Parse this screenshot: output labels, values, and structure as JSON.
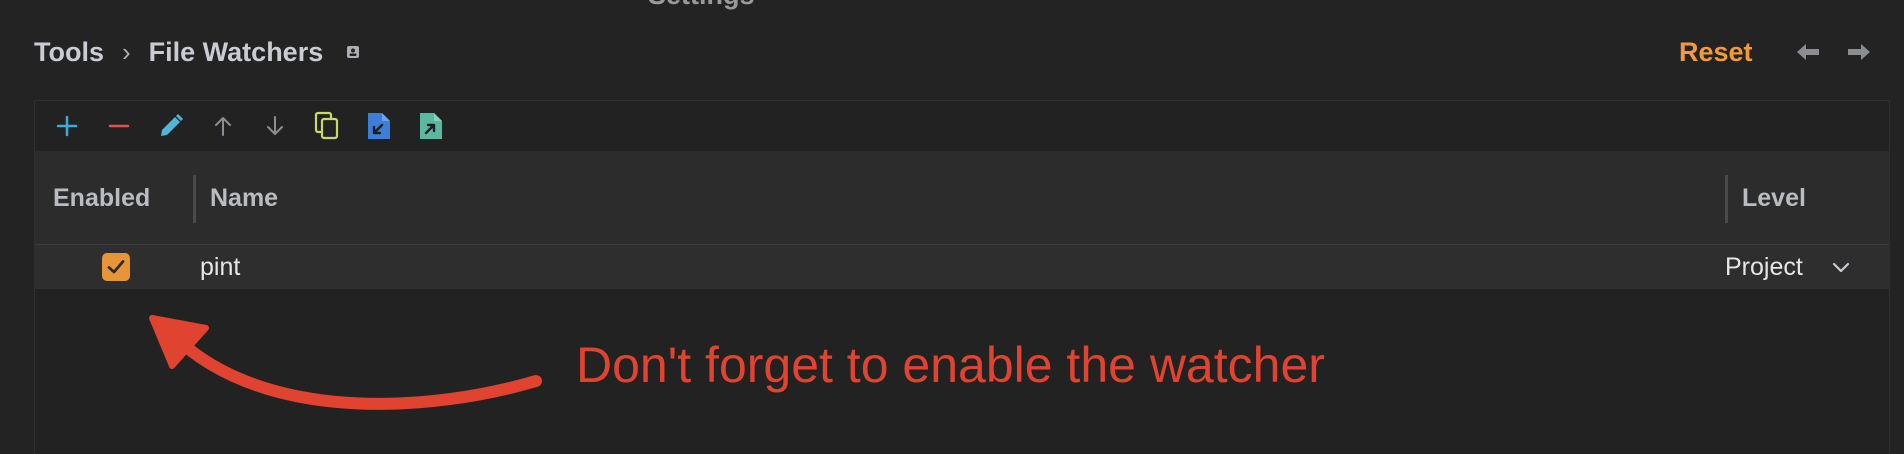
{
  "window": {
    "title": "Settings"
  },
  "breadcrumb": {
    "items": [
      "Tools",
      "File Watchers"
    ],
    "separator": "›"
  },
  "header_actions": {
    "reset_label": "Reset"
  },
  "toolbar": {
    "buttons": [
      {
        "icon": "plus-icon",
        "color": "#3fa9d8"
      },
      {
        "icon": "minus-icon",
        "color": "#e05252"
      },
      {
        "icon": "edit-icon",
        "color": "#4fb5d9"
      },
      {
        "icon": "arrow-up-icon",
        "color": "#8a8f95"
      },
      {
        "icon": "arrow-down-icon",
        "color": "#8a8f95"
      },
      {
        "icon": "copy-icon",
        "color": "#c8d86a"
      },
      {
        "icon": "import-icon",
        "color": "#3d7fd6"
      },
      {
        "icon": "export-icon",
        "color": "#5ab7a0"
      }
    ]
  },
  "table": {
    "columns": [
      "Enabled",
      "Name",
      "Level"
    ],
    "rows": [
      {
        "enabled": true,
        "name": "pint",
        "level": "Project"
      }
    ]
  },
  "annotation": {
    "text": "Don't forget to enable the watcher",
    "color": "#e0432f"
  },
  "colors": {
    "accent": "#f09a3c",
    "checkbox": "#e8953a",
    "background": "#232323"
  }
}
